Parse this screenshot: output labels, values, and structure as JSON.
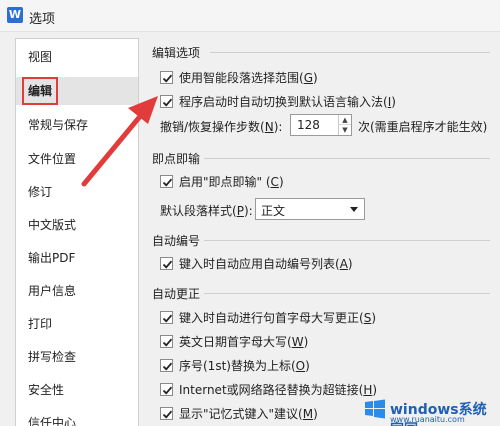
{
  "window": {
    "title": "选项",
    "icon": "wps-writer-icon"
  },
  "sidebar": {
    "items": [
      {
        "label": "视图"
      },
      {
        "label": "编辑",
        "selected": true
      },
      {
        "label": "常规与保存"
      },
      {
        "label": "文件位置"
      },
      {
        "label": "修订"
      },
      {
        "label": "中文版式"
      },
      {
        "label": "输出PDF"
      },
      {
        "label": "用户信息"
      },
      {
        "label": "打印"
      },
      {
        "label": "拼写检查"
      },
      {
        "label": "安全性"
      },
      {
        "label": "信任中心"
      }
    ]
  },
  "edit_options": {
    "title": "编辑选项",
    "smart_paragraph": {
      "text": "使用智能段落选择范围",
      "key": "G",
      "checked": true
    },
    "auto_ime": {
      "text": "程序启动时自动切换到默认语言输入法",
      "key": "I",
      "checked": true
    },
    "undo_label_text": "撤销/恢复操作步数",
    "undo_label_key": "N",
    "undo_value": "128",
    "undo_note": "次(需重启程序才能生效)"
  },
  "instant_input": {
    "title": "即点即输",
    "enable": {
      "text": "启用\"即点即输\"",
      "key": "C",
      "checked": true
    },
    "style_label_text": "默认段落样式",
    "style_label_key": "P",
    "style_value": "正文"
  },
  "auto_numbering": {
    "title": "自动编号",
    "apply": {
      "text": "键入时自动应用自动编号列表",
      "key": "A",
      "checked": true
    }
  },
  "auto_correct": {
    "title": "自动更正",
    "items": [
      {
        "text": "键入时自动进行句首字母大写更正",
        "key": "S",
        "checked": true
      },
      {
        "text": "英文日期首字母大写",
        "key": "W",
        "checked": true
      },
      {
        "text": "序号(1st)替换为上标",
        "key": "O",
        "checked": true
      },
      {
        "text": "Internet或网络路径替换为超链接",
        "key": "H",
        "checked": true
      },
      {
        "text": "显示\"记忆式键入\"建议",
        "key": "M",
        "checked": true
      }
    ]
  },
  "watermark": {
    "brand": "windows系统家园",
    "url": "www.ruanaitu.com"
  },
  "colors": {
    "highlight": "#e23b3b",
    "arrow": "#e23b3b",
    "selected_bg": "#e4e4e4"
  }
}
